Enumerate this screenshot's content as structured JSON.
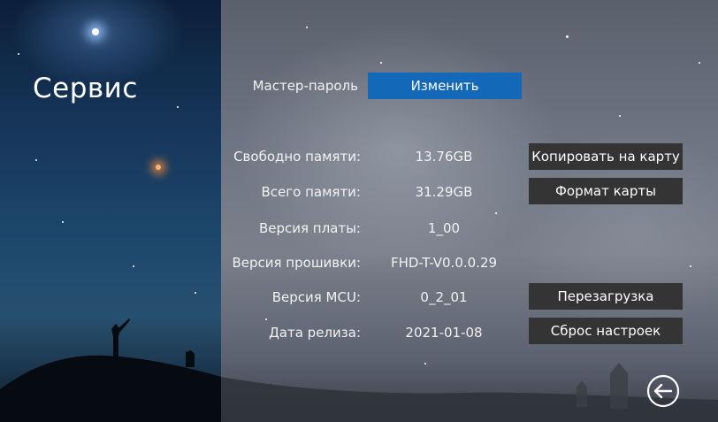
{
  "page": {
    "title": "Сервис"
  },
  "master_password": {
    "label": "Мастер-пароль",
    "button_label": "Изменить"
  },
  "info_rows": [
    {
      "label": "Свободно памяти:",
      "value": "13.76GB"
    },
    {
      "label": "Всего памяти:",
      "value": "31.29GB"
    },
    {
      "label": "Версия платы:",
      "value": "1_00"
    },
    {
      "label": "Версия прошивки:",
      "value": "FHD-T-V0.0.0.29"
    },
    {
      "label": "Версия MCU:",
      "value": "0_2_01"
    },
    {
      "label": "Дата релиза:",
      "value": "2021-01-08"
    }
  ],
  "actions": {
    "copy_to_card": "Копировать на карту",
    "format_card": "Формат карты",
    "reboot": "Перезагрузка",
    "reset_settings": "Сброс настроек"
  },
  "icons": {
    "back": "back-arrow-icon"
  },
  "colors": {
    "accent_button": "#1468b8",
    "dark_button": "#343434"
  }
}
